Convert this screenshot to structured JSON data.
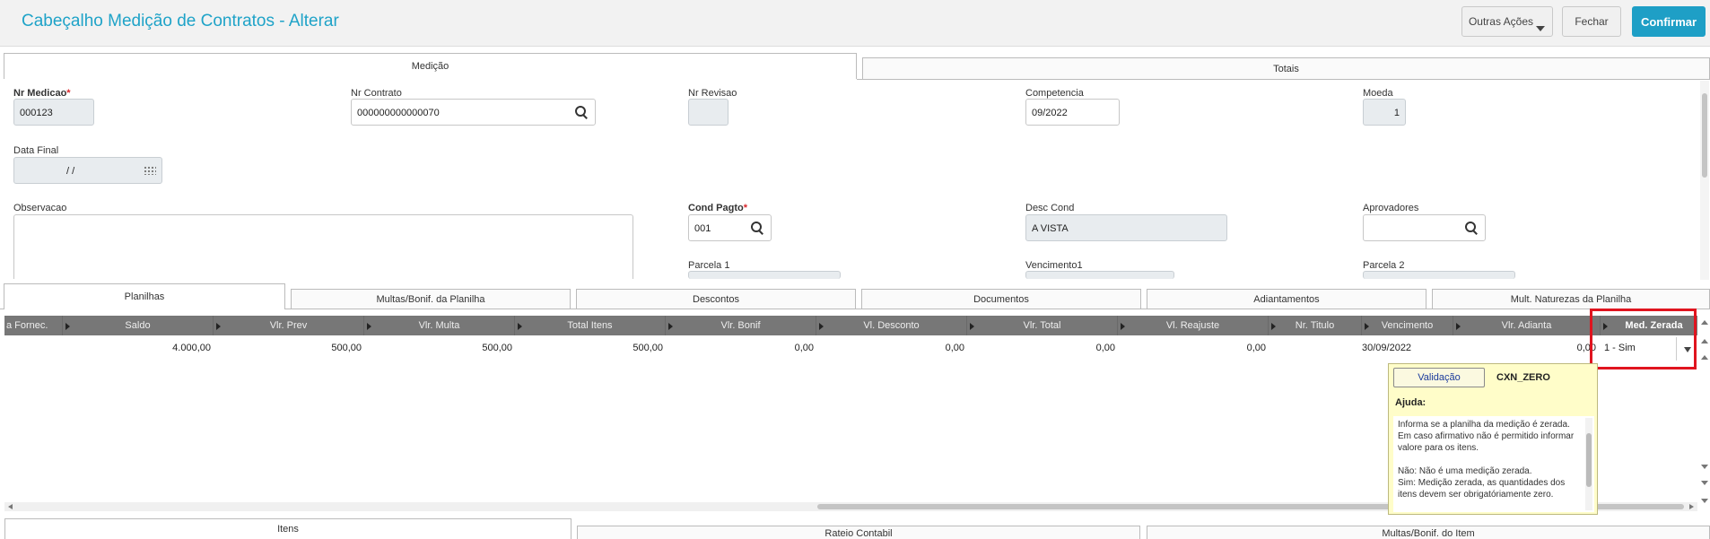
{
  "header": {
    "title": "Cabeçalho Medição de Contratos - Alterar",
    "btn_outras": "Outras Ações",
    "btn_fechar": "Fechar",
    "btn_confirmar": "Confirmar"
  },
  "top_tabs": {
    "medicao": "Medição",
    "totais": "Totais"
  },
  "form": {
    "nr_medicao_label": "Nr Medicao",
    "nr_medicao_value": "000123",
    "nr_contrato_label": "Nr Contrato",
    "nr_contrato_value": "000000000000070",
    "nr_revisao_label": "Nr Revisao",
    "nr_revisao_value": "",
    "competencia_label": "Competencia",
    "competencia_value": "09/2022",
    "moeda_label": "Moeda",
    "moeda_value": "1",
    "data_final_label": "Data Final",
    "data_final_value": "/ /",
    "observacao_label": "Observacao",
    "cond_pagto_label": "Cond Pagto",
    "cond_pagto_value": "001",
    "desc_cond_label": "Desc Cond",
    "desc_cond_value": "A VISTA",
    "aprovadores_label": "Aprovadores",
    "aprovadores_value": "",
    "parcela1_label": "Parcela 1",
    "vencimento1_label": "Vencimento1",
    "parcela2_label": "Parcela 2",
    "required_mark": "*"
  },
  "mid_tabs": {
    "planilhas": "Planilhas",
    "multas": "Multas/Bonif. da Planilha",
    "descontos": "Descontos",
    "documentos": "Documentos",
    "adiantamentos": "Adiantamentos",
    "naturezas": "Mult. Naturezas da Planilha"
  },
  "grid": {
    "headers": {
      "fornec": "a Fornec.",
      "saldo": "Saldo",
      "vlr_prev": "Vlr. Prev",
      "vlr_multa": "Vlr. Multa",
      "total_itens": "Total Itens",
      "vlr_bonif": "Vlr. Bonif",
      "vl_desconto": "Vl. Desconto",
      "vlr_total": "Vlr. Total",
      "vl_reajuste": "Vl. Reajuste",
      "nr_titulo": "Nr. Titulo",
      "vencimento": "Vencimento",
      "vlr_adianta": "Vlr. Adianta",
      "med_zerada": "Med. Zerada"
    },
    "row": {
      "saldo": "4.000,00",
      "vlr_prev": "500,00",
      "vlr_multa": "500,00",
      "total_itens": "500,00",
      "vlr_bonif": "0,00",
      "vl_desconto": "0,00",
      "vlr_total": "0,00",
      "vl_reajuste": "0,00",
      "vencimento": "30/09/2022",
      "vlr_adianta": "0,00",
      "med_zerada": "1 - Sim"
    }
  },
  "popup": {
    "validacao": "Validação",
    "code": "CXN_ZERO",
    "ajuda": "Ajuda:",
    "text1": "Informa se a planilha da medição é zerada. Em caso afirmativo não é permitido informar valore para os itens.",
    "text2": "Não: Não é uma medição zerada.",
    "text3": "Sim: Medição zerada, as quantidades dos itens devem ser obrigatóriamente zero."
  },
  "bottom_tabs": {
    "itens": "Itens",
    "rateio": "Rateio Contabil",
    "multas_item": "Multas/Bonif. do Item"
  },
  "colors": {
    "accent": "#1e9fc6",
    "title": "#1fa3c8",
    "highlight": "#e0141f",
    "required": "#d9262b"
  }
}
